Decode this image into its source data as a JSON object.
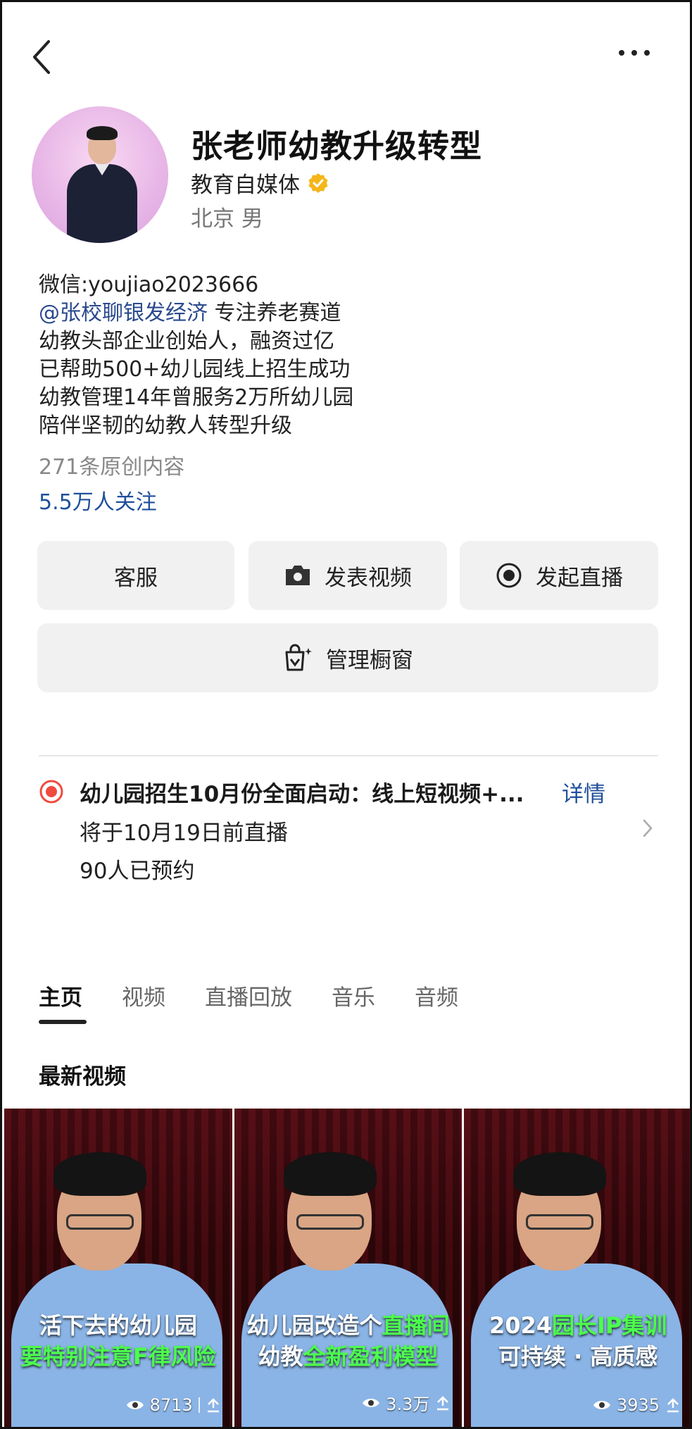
{
  "profile": {
    "name": "张老师幼教升级转型",
    "tag": "教育自媒体",
    "location": "北京 男"
  },
  "bio": {
    "line1": "微信:youjiao2023666",
    "mention": "@张校聊银发经济",
    "line2_rest": " 专注养老赛道",
    "line3": "幼教头部企业创始人，融资过亿",
    "line4": "已帮助500+幼儿园线上招生成功",
    "line5": "幼教管理14年曾服务2万所幼儿园",
    "line6": "陪伴坚韧的幼教人转型升级"
  },
  "stats": {
    "original_count": "271条原创内容",
    "followers": "5.5万人关注"
  },
  "buttons": {
    "customer_service": "客服",
    "post_video": "发表视频",
    "start_live": "发起直播",
    "manage_shop": "管理橱窗"
  },
  "live": {
    "title": "幼儿园招生10月份全面启动：线上短视频+...",
    "detail": "详情",
    "time": "将于10月19日前直播",
    "reserved": "90人已预约"
  },
  "tabs": [
    "主页",
    "视频",
    "直播回放",
    "音乐",
    "音频"
  ],
  "active_tab": "主页",
  "section_title": "最新视频",
  "videos": [
    {
      "caption_line1": "活下去的幼儿园",
      "caption_line2": "要特别注意F律风险",
      "views": "8713"
    },
    {
      "caption_line1_a": "幼儿园改造个",
      "caption_line1_b": "直播间",
      "caption_line2_a": "幼教",
      "caption_line2_b": "全新盈利模型",
      "views": "3.3万"
    },
    {
      "caption_line1_a": "2024",
      "caption_line1_b": "园长IP集训",
      "caption_line2": "可持续 · 高质感",
      "views": "3935"
    }
  ],
  "icons": [
    "back-icon",
    "more-icon",
    "verified-icon",
    "camera-icon",
    "record-icon",
    "shop-bag-icon",
    "live-dot-icon",
    "chevron-right-icon",
    "eye-icon",
    "share-icon"
  ],
  "colors": {
    "link": "#1f4f9a",
    "verified": "#f5b61a",
    "live_red": "#ef4b3f",
    "caption_highlight": "#4cff4c"
  }
}
